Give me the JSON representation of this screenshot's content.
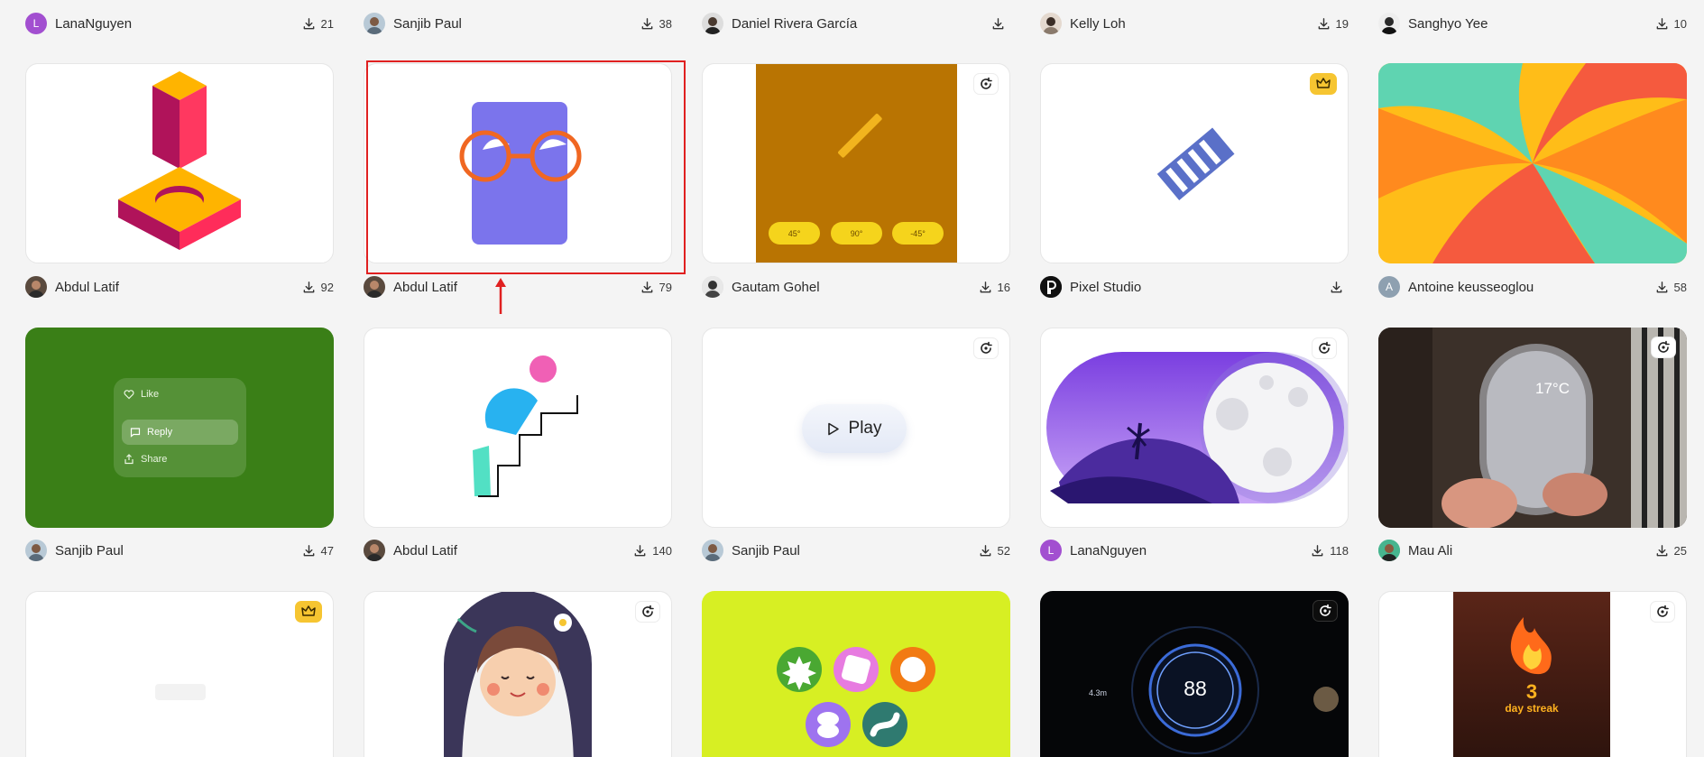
{
  "top_row": [
    {
      "author": "LanaNguyen",
      "downloads": "21"
    },
    {
      "author": "Sanjib Paul",
      "downloads": "38"
    },
    {
      "author": "Daniel Rivera García",
      "downloads": ""
    },
    {
      "author": "Kelly Loh",
      "downloads": "19"
    },
    {
      "author": "Sanghyo Yee",
      "downloads": "10"
    }
  ],
  "row1": [
    {
      "author": "Abdul Latif",
      "downloads": "92"
    },
    {
      "author": "Abdul Latif",
      "downloads": "79"
    },
    {
      "author": "Gautam Gohel",
      "downloads": "16",
      "labels": [
        "45°",
        "90°",
        "-45°"
      ]
    },
    {
      "author": "Pixel Studio",
      "downloads": ""
    },
    {
      "author": "Antoine keusseoglou",
      "downloads": "58"
    }
  ],
  "row2": [
    {
      "author": "Sanjib Paul",
      "downloads": "47",
      "menu": [
        "Like",
        "Reply",
        "Share"
      ]
    },
    {
      "author": "Abdul Latif",
      "downloads": "140"
    },
    {
      "author": "Sanjib Paul",
      "downloads": "52",
      "button": "Play"
    },
    {
      "author": "LanaNguyen",
      "downloads": "118"
    },
    {
      "author": "Mau Ali",
      "downloads": "25",
      "temp": "17°C"
    }
  ],
  "row3": [
    {
      "dash_speed": "88",
      "dash_dist": "4.3m",
      "streak_num": "3",
      "streak_text": "day streak"
    }
  ],
  "avatar_letters": {
    "lana": "L",
    "antoine": "A"
  },
  "colors": {
    "highlight": "#e02020",
    "crown": "#f6c531",
    "green_card": "#3a7f17",
    "lime_card": "#d7ef23"
  }
}
